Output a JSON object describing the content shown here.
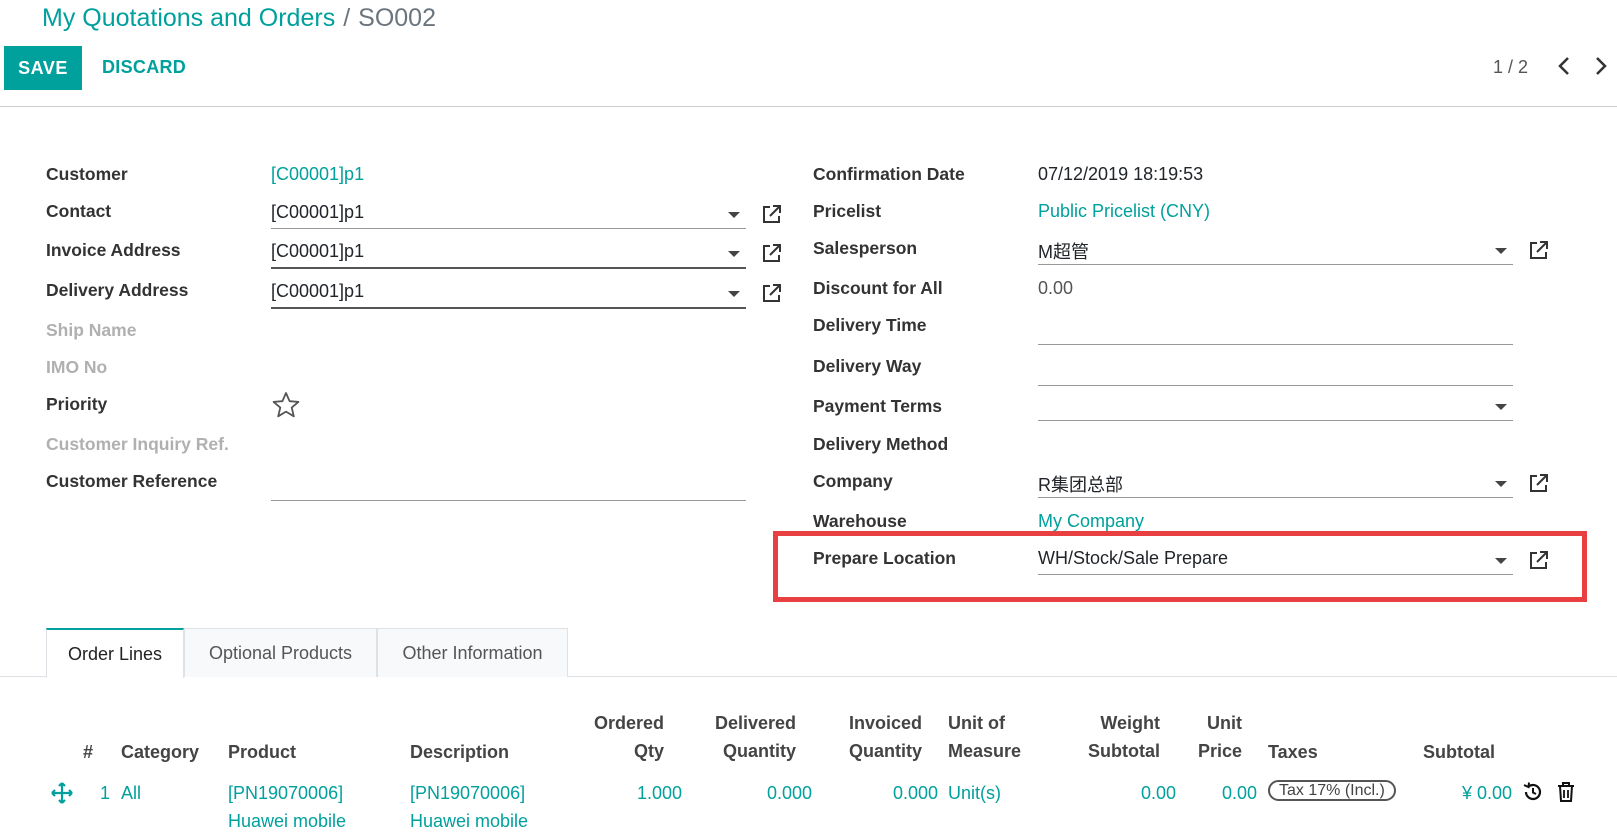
{
  "breadcrumb": {
    "parent": "My Quotations and Orders",
    "separator": "/",
    "current": "SO002"
  },
  "toolbar": {
    "save_label": "SAVE",
    "discard_label": "DISCARD",
    "pager": "1 / 2"
  },
  "left_fields": {
    "customer": {
      "label": "Customer",
      "value": "[C00001]p1"
    },
    "contact": {
      "label": "Contact",
      "value": "[C00001]p1"
    },
    "invoice_address": {
      "label": "Invoice Address",
      "value": "[C00001]p1"
    },
    "delivery_address": {
      "label": "Delivery Address",
      "value": "[C00001]p1"
    },
    "ship_name": {
      "label": "Ship Name"
    },
    "imo_no": {
      "label": "IMO No"
    },
    "priority": {
      "label": "Priority"
    },
    "customer_inquiry_ref": {
      "label": "Customer Inquiry Ref."
    },
    "customer_reference": {
      "label": "Customer Reference",
      "value": ""
    }
  },
  "right_fields": {
    "confirmation_date": {
      "label": "Confirmation Date",
      "value": "07/12/2019 18:19:53"
    },
    "pricelist": {
      "label": "Pricelist",
      "value": "Public Pricelist (CNY)"
    },
    "salesperson": {
      "label": "Salesperson",
      "value": "M超管"
    },
    "discount_for_all": {
      "label": "Discount for All",
      "value": "0.00"
    },
    "delivery_time": {
      "label": "Delivery Time",
      "value": ""
    },
    "delivery_way": {
      "label": "Delivery Way",
      "value": ""
    },
    "payment_terms": {
      "label": "Payment Terms",
      "value": ""
    },
    "delivery_method": {
      "label": "Delivery Method"
    },
    "company": {
      "label": "Company",
      "value": "R集团总部"
    },
    "warehouse": {
      "label": "Warehouse",
      "value": "My Company"
    },
    "prepare_location": {
      "label": "Prepare Location",
      "value": "WH/Stock/Sale Prepare"
    }
  },
  "tabs": [
    {
      "label": "Order Lines",
      "active": true
    },
    {
      "label": "Optional Products",
      "active": false
    },
    {
      "label": "Other Information",
      "active": false
    }
  ],
  "table": {
    "headers": {
      "num": "#",
      "category": "Category",
      "product": "Product",
      "description": "Description",
      "ordered_qty_1": "Ordered",
      "ordered_qty_2": "Qty",
      "delivered_1": "Delivered",
      "delivered_2": "Quantity",
      "invoiced_1": "Invoiced",
      "invoiced_2": "Quantity",
      "uom_1": "Unit of",
      "uom_2": "Measure",
      "weight_1": "Weight",
      "weight_2": "Subtotal",
      "price_1": "Unit",
      "price_2": "Price",
      "taxes": "Taxes",
      "subtotal": "Subtotal"
    },
    "rows": [
      {
        "num": "1",
        "category": "All",
        "product_1": "[PN19070006]",
        "product_2": "Huawei mobile",
        "description_1": "[PN19070006]",
        "description_2": "Huawei mobile",
        "ordered_qty": "1.000",
        "delivered": "0.000",
        "invoiced": "0.000",
        "uom": "Unit(s)",
        "weight": "0.00",
        "price": "0.00",
        "tax": "Tax 17% (Incl.)",
        "subtotal": "¥ 0.00"
      }
    ]
  },
  "colors": {
    "accent": "#00A09D",
    "highlight": "#E84040"
  },
  "icons": [
    "external-link-icon",
    "caret-down-icon",
    "star-icon",
    "chevron-left-icon",
    "chevron-right-icon",
    "drag-handle-icon",
    "history-icon",
    "trash-icon"
  ]
}
